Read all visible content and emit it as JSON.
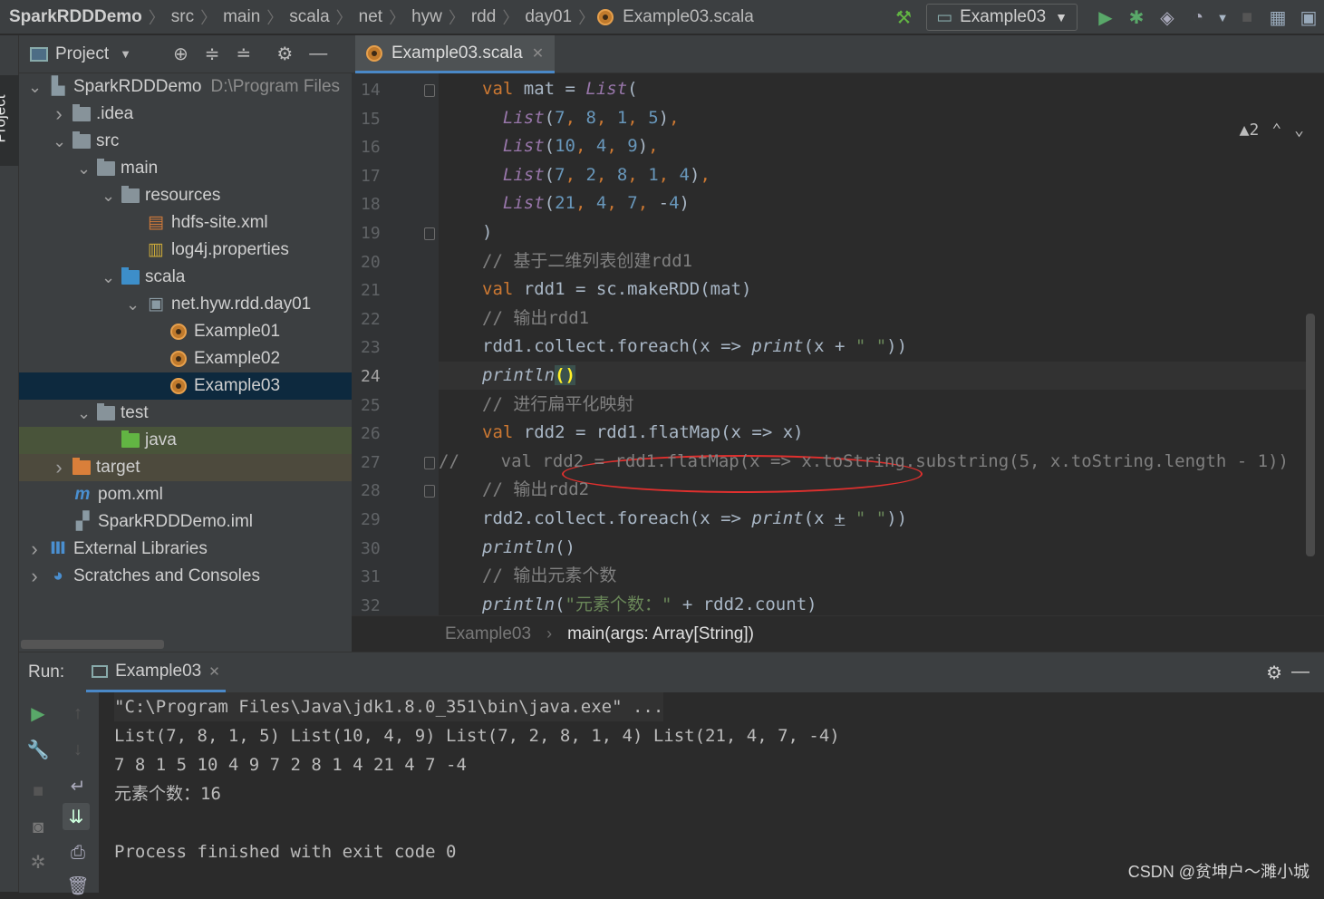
{
  "breadcrumbs": [
    "SparkRDDDemo",
    "src",
    "main",
    "scala",
    "net",
    "hyw",
    "rdd",
    "day01",
    "Example03.scala"
  ],
  "run_config": "Example03",
  "project_panel": {
    "title": "Project",
    "side_tab": "Project",
    "tree": [
      {
        "label": "SparkRDDDemo",
        "extra": "D:\\Program Files",
        "depth": 0,
        "arrow": "down",
        "icon": "module"
      },
      {
        "label": ".idea",
        "depth": 1,
        "arrow": "right",
        "icon": "folder"
      },
      {
        "label": "src",
        "depth": 1,
        "arrow": "down",
        "icon": "folder"
      },
      {
        "label": "main",
        "depth": 2,
        "arrow": "down",
        "icon": "folder"
      },
      {
        "label": "resources",
        "depth": 3,
        "arrow": "down",
        "icon": "folder"
      },
      {
        "label": "hdfs-site.xml",
        "depth": 4,
        "arrow": "",
        "icon": "xml"
      },
      {
        "label": "log4j.properties",
        "depth": 4,
        "arrow": "",
        "icon": "props"
      },
      {
        "label": "scala",
        "depth": 3,
        "arrow": "down",
        "icon": "folder-blue"
      },
      {
        "label": "net.hyw.rdd.day01",
        "depth": 4,
        "arrow": "down",
        "icon": "package"
      },
      {
        "label": "Example01",
        "depth": 5,
        "arrow": "",
        "icon": "scala"
      },
      {
        "label": "Example02",
        "depth": 5,
        "arrow": "",
        "icon": "scala"
      },
      {
        "label": "Example03",
        "depth": 5,
        "arrow": "",
        "icon": "scala",
        "state": "sel"
      },
      {
        "label": "test",
        "depth": 2,
        "arrow": "down",
        "icon": "folder"
      },
      {
        "label": "java",
        "depth": 3,
        "arrow": "",
        "icon": "folder-green",
        "state": "java"
      },
      {
        "label": "target",
        "depth": 1,
        "arrow": "right",
        "icon": "folder-orange",
        "state": "target"
      },
      {
        "label": "pom.xml",
        "depth": 1,
        "arrow": "",
        "icon": "maven"
      },
      {
        "label": "SparkRDDDemo.iml",
        "depth": 1,
        "arrow": "",
        "icon": "iml"
      },
      {
        "label": "External Libraries",
        "depth": 0,
        "arrow": "right",
        "icon": "libs"
      },
      {
        "label": "Scratches and Consoles",
        "depth": 0,
        "arrow": "right",
        "icon": "scratch"
      }
    ]
  },
  "editor": {
    "tab": "Example03.scala",
    "warnings": "2",
    "current_line": 24,
    "lines": [
      {
        "n": 14,
        "html": "<span class='kw'>val</span> mat = <span class='it'>List</span>("
      },
      {
        "n": 15,
        "html": "  <span class='it'>List</span>(<span class='num'>7</span><span class='kw'>,</span> <span class='num'>8</span><span class='kw'>,</span> <span class='num'>1</span><span class='kw'>,</span> <span class='num'>5</span>)<span class='kw'>,</span>"
      },
      {
        "n": 16,
        "html": "  <span class='it'>List</span>(<span class='num'>10</span><span class='kw'>,</span> <span class='num'>4</span><span class='kw'>,</span> <span class='num'>9</span>)<span class='kw'>,</span>"
      },
      {
        "n": 17,
        "html": "  <span class='it'>List</span>(<span class='num'>7</span><span class='kw'>,</span> <span class='num'>2</span><span class='kw'>,</span> <span class='num'>8</span><span class='kw'>,</span> <span class='num'>1</span><span class='kw'>,</span> <span class='num'>4</span>)<span class='kw'>,</span>"
      },
      {
        "n": 18,
        "html": "  <span class='it'>List</span>(<span class='num'>21</span><span class='kw'>,</span> <span class='num'>4</span><span class='kw'>,</span> <span class='num'>7</span><span class='kw'>,</span> -<span class='num'>4</span>)"
      },
      {
        "n": 19,
        "html": ")"
      },
      {
        "n": 20,
        "html": "<span class='cm'>// 基于二维列表创建rdd1</span>"
      },
      {
        "n": 21,
        "html": "<span class='kw'>val</span> rdd1 = sc.makeRDD(mat)"
      },
      {
        "n": 22,
        "html": "<span class='cm'>// 输出rdd1</span>"
      },
      {
        "n": 23,
        "html": "rdd1.collect.foreach(x => <span class='fn'>print</span>(x + <span class='str'>\" \"</span>))"
      },
      {
        "n": 24,
        "html": "<span class='fn'>println</span><span class='brk'>()</span>"
      },
      {
        "n": 25,
        "html": "<span class='cm'>// 进行扁平化映射</span>"
      },
      {
        "n": 26,
        "html": "<span class='kw'>val</span> rdd2 = rdd1.flatMap(x => x)"
      },
      {
        "n": 27,
        "html": "<span class='cm'>//    val rdd2 = rdd1.flatMap(x => x.toString.substring(5, x.toString.length - 1))</span>"
      },
      {
        "n": 28,
        "html": "<span class='cm'>// 输出rdd2</span>"
      },
      {
        "n": 29,
        "html": "rdd2.collect.foreach(x => <span class='fn'>print</span>(x <u>+</u> <span class='str'>\" \"</span>))"
      },
      {
        "n": 30,
        "html": "<span class='fn'>println</span>()"
      },
      {
        "n": 31,
        "html": "<span class='cm'>// 输出元素个数</span>"
      },
      {
        "n": 32,
        "html": "<span class='fn'>println</span>(<span class='str'>\"元素个数：\"</span> + rdd2.count)"
      }
    ],
    "footer_crumbs": [
      "Example03",
      "main(args: Array[String])"
    ]
  },
  "run_panel": {
    "label": "Run:",
    "tab": "Example03",
    "console": [
      "\"C:\\Program Files\\Java\\jdk1.8.0_351\\bin\\java.exe\" ...",
      "List(7, 8, 1, 5) List(10, 4, 9) List(7, 2, 8, 1, 4) List(21, 4, 7, -4)",
      "7 8 1 5 10 4 9 7 2 8 1 4 21 4 7 -4",
      "元素个数：16",
      "",
      "Process finished with exit code 0"
    ]
  },
  "watermark": "CSDN @贫坤户～濉小城",
  "colors": {
    "keyword": "#cc7832",
    "number": "#6897bb",
    "comment": "#808080",
    "string": "#6a8759",
    "selection": "#0d293e",
    "annotation": "#e0302e"
  }
}
